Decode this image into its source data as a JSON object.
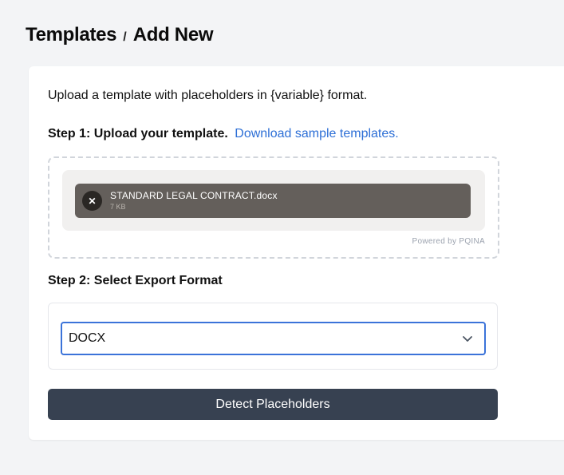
{
  "breadcrumb": {
    "parent": "Templates",
    "separator": "/",
    "current": "Add New"
  },
  "intro_text": "Upload a template with placeholders in {variable} format.",
  "step1": {
    "label": "Step 1: Upload your template.",
    "link_text": "Download sample templates."
  },
  "upload": {
    "file_name": "STANDARD LEGAL CONTRACT.docx",
    "file_size": "7 KB",
    "remove_glyph": "✕",
    "powered_by": "Powered by PQINA"
  },
  "step2": {
    "label": "Step 2: Select Export Format"
  },
  "export_format": {
    "selected": "DOCX"
  },
  "detect_button": "Detect Placeholders",
  "colors": {
    "accent_blue": "#2d6fd6",
    "focus_border": "#3b73d9",
    "button_bg": "#374151",
    "file_item_bg": "#645f5b",
    "annotation_arrow": "#e8371c"
  },
  "icons": {
    "remove": "close-icon",
    "select": "chevron-down-icon",
    "annotation": "red-arrow-icon"
  }
}
